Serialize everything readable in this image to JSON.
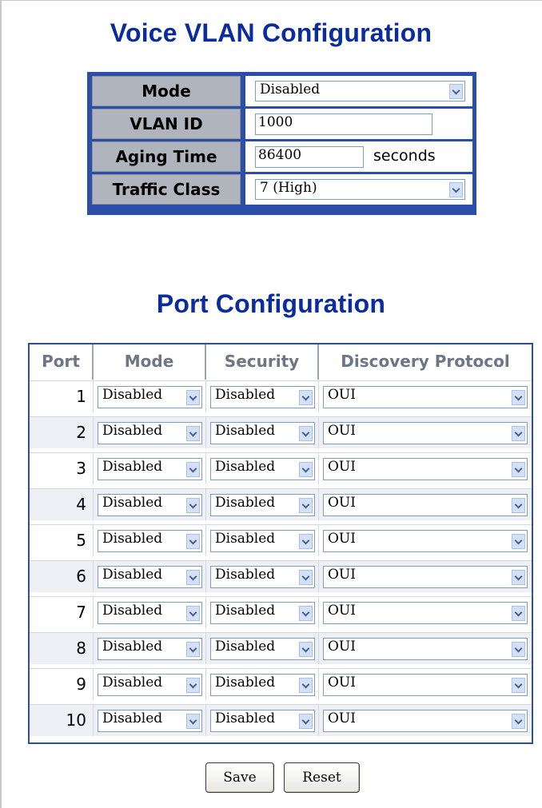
{
  "title": "Voice VLAN Configuration",
  "voice": {
    "mode_label": "Mode",
    "mode_value": "Disabled",
    "vlan_id_label": "VLAN ID",
    "vlan_id_value": "1000",
    "aging_label": "Aging Time",
    "aging_value": "86400",
    "aging_unit": "seconds",
    "traffic_label": "Traffic Class",
    "traffic_value": "7 (High)"
  },
  "port_title": "Port Configuration",
  "port_table": {
    "headers": [
      "Port",
      "Mode",
      "Security",
      "Discovery Protocol"
    ],
    "rows": [
      {
        "port": "1",
        "mode": "Disabled",
        "security": "Disabled",
        "protocol": "OUI"
      },
      {
        "port": "2",
        "mode": "Disabled",
        "security": "Disabled",
        "protocol": "OUI"
      },
      {
        "port": "3",
        "mode": "Disabled",
        "security": "Disabled",
        "protocol": "OUI"
      },
      {
        "port": "4",
        "mode": "Disabled",
        "security": "Disabled",
        "protocol": "OUI"
      },
      {
        "port": "5",
        "mode": "Disabled",
        "security": "Disabled",
        "protocol": "OUI"
      },
      {
        "port": "6",
        "mode": "Disabled",
        "security": "Disabled",
        "protocol": "OUI"
      },
      {
        "port": "7",
        "mode": "Disabled",
        "security": "Disabled",
        "protocol": "OUI"
      },
      {
        "port": "8",
        "mode": "Disabled",
        "security": "Disabled",
        "protocol": "OUI"
      },
      {
        "port": "9",
        "mode": "Disabled",
        "security": "Disabled",
        "protocol": "OUI"
      },
      {
        "port": "10",
        "mode": "Disabled",
        "security": "Disabled",
        "protocol": "OUI"
      }
    ]
  },
  "buttons": {
    "save": "Save",
    "reset": "Reset"
  },
  "colors": {
    "heading": "#0a2c9c",
    "table_border": "#2b4fa8",
    "label_bg": "#b0b4bd"
  }
}
